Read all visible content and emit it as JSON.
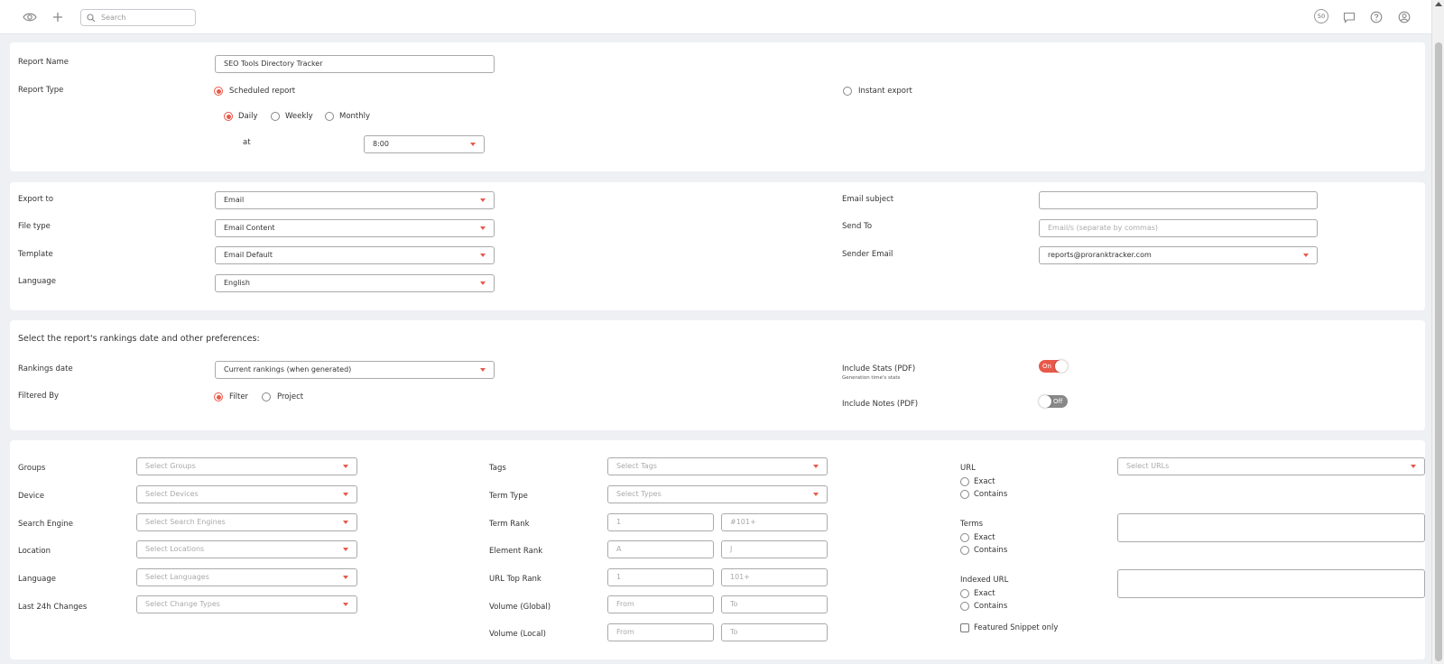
{
  "topbar": {
    "search_placeholder": "Search",
    "credits_badge": "50",
    "icons": [
      "eye-icon",
      "plus-icon",
      "search-icon",
      "chat-icon",
      "help-icon",
      "user-icon"
    ]
  },
  "report": {
    "name_label": "Report Name",
    "name_value": "SEO Tools Directory Tracker",
    "type_label": "Report Type",
    "scheduled_label": "Scheduled report",
    "instant_label": "Instant export",
    "daily_label": "Daily",
    "weekly_label": "Weekly",
    "monthly_label": "Monthly",
    "at_label": "at",
    "time_value": "8:00"
  },
  "export": {
    "export_to_label": "Export to",
    "export_to_value": "Email",
    "file_type_label": "File type",
    "file_type_value": "Email Content",
    "template_label": "Template",
    "template_value": "Email Default",
    "language_label": "Language",
    "language_value": "English",
    "email_subject_label": "Email subject",
    "email_subject_value": "",
    "send_to_label": "Send To",
    "send_to_placeholder": "Email/s (separate by commas)",
    "sender_email_label": "Sender Email",
    "sender_email_value": "reports@proranktracker.com"
  },
  "prefs": {
    "heading": "Select the report's rankings date and other preferences:",
    "rankings_date_label": "Rankings date",
    "rankings_date_value": "Current rankings (when generated)",
    "filtered_by_label": "Filtered By",
    "filter_label": "Filter",
    "project_label": "Project",
    "include_stats_label": "Include Stats (PDF)",
    "include_stats_sub": "Generation time's stats",
    "include_stats_toggle": "On",
    "include_notes_label": "Include Notes (PDF)",
    "include_notes_toggle": "Off"
  },
  "filters": {
    "groups_label": "Groups",
    "groups_placeholder": "Select Groups",
    "device_label": "Device",
    "device_placeholder": "Select Devices",
    "search_engine_label": "Search Engine",
    "search_engine_placeholder": "Select Search Engines",
    "location_label": "Location",
    "location_placeholder": "Select Locations",
    "language_label": "Language",
    "language_placeholder": "Select Languages",
    "last24_label": "Last 24h Changes",
    "last24_placeholder": "Select Change Types",
    "tags_label": "Tags",
    "tags_placeholder": "Select Tags",
    "term_type_label": "Term Type",
    "term_type_placeholder": "Select Types",
    "term_rank_label": "Term Rank",
    "term_rank_from": "1",
    "term_rank_to": "#101+",
    "element_rank_label": "Element Rank",
    "element_rank_from": "A",
    "element_rank_to": "J",
    "url_top_rank_label": "URL Top Rank",
    "url_top_rank_from": "1",
    "url_top_rank_to": "101+",
    "volume_global_label": "Volume (Global)",
    "volume_local_label": "Volume (Local)",
    "from_placeholder": "From",
    "to_placeholder": "To",
    "url_label": "URL",
    "url_placeholder": "Select URLs",
    "terms_label": "Terms",
    "indexed_url_label": "Indexed URL",
    "exact_label": "Exact",
    "contains_label": "Contains",
    "featured_snippet_label": "Featured Snippet only"
  },
  "colors": {
    "accent": "#e8594a",
    "background": "#eef0f4"
  }
}
